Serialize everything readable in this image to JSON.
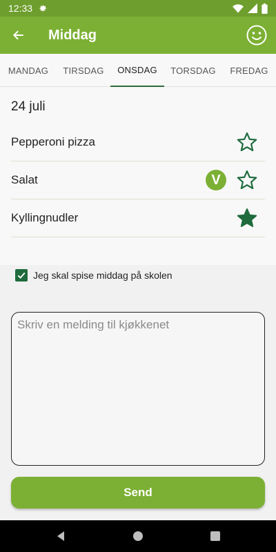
{
  "status_bar": {
    "time": "12:33",
    "icons": [
      "gear-icon",
      "wifi-icon",
      "signal-icon",
      "battery-icon"
    ]
  },
  "app_bar": {
    "title": "Middag",
    "back_icon": "arrow-left-icon",
    "action_icon": "smiley-icon"
  },
  "tabs": [
    {
      "label": "MANDAG",
      "active": false
    },
    {
      "label": "TIRSDAG",
      "active": false
    },
    {
      "label": "ONSDAG",
      "active": true
    },
    {
      "label": "TORSDAG",
      "active": false
    },
    {
      "label": "FREDAG",
      "active": false
    }
  ],
  "day": {
    "date": "24 juli"
  },
  "menu": [
    {
      "name": "Pepperoni pizza",
      "vegetarian": false,
      "favorite": false
    },
    {
      "name": "Salat",
      "vegetarian": true,
      "vegetarian_badge": "V",
      "favorite": false
    },
    {
      "name": "Kyllingnudler",
      "vegetarian": false,
      "favorite": true
    }
  ],
  "checkbox": {
    "label": "Jeg skal spise middag på skolen",
    "checked": true
  },
  "message": {
    "placeholder": "Skriv en melding til kjøkkenet",
    "value": ""
  },
  "send": {
    "label": "Send"
  },
  "colors": {
    "primary": "#7cb034",
    "status": "#6e9e2d",
    "dark_green": "#1f6b3d",
    "star": "#1f6b3d"
  }
}
